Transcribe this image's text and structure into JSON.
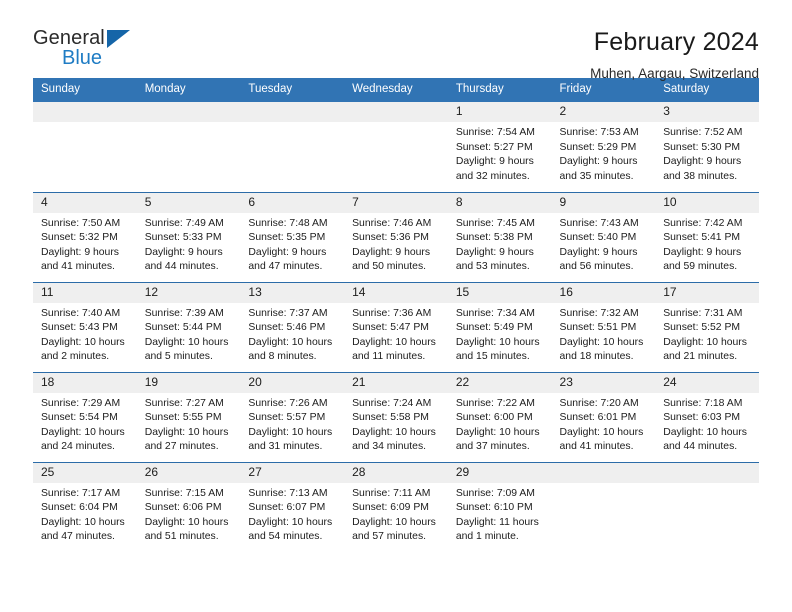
{
  "logo": {
    "word_one": "General",
    "word_two": "Blue",
    "triangle": "triangle-mark"
  },
  "header": {
    "title": "February 2024",
    "location": "Muhen, Aargau, Switzerland"
  },
  "calendar": {
    "weekdays": [
      "Sunday",
      "Monday",
      "Tuesday",
      "Wednesday",
      "Thursday",
      "Friday",
      "Saturday"
    ],
    "accent_color": "#3174b4",
    "rule_color": "#2c6ca8",
    "daynum_band_color": "#efefef",
    "weeks": [
      [
        {
          "day": ""
        },
        {
          "day": ""
        },
        {
          "day": ""
        },
        {
          "day": ""
        },
        {
          "day": "1",
          "sunrise": "Sunrise: 7:54 AM",
          "sunset": "Sunset: 5:27 PM",
          "daylight_line1": "Daylight: 9 hours",
          "daylight_line2": "and 32 minutes."
        },
        {
          "day": "2",
          "sunrise": "Sunrise: 7:53 AM",
          "sunset": "Sunset: 5:29 PM",
          "daylight_line1": "Daylight: 9 hours",
          "daylight_line2": "and 35 minutes."
        },
        {
          "day": "3",
          "sunrise": "Sunrise: 7:52 AM",
          "sunset": "Sunset: 5:30 PM",
          "daylight_line1": "Daylight: 9 hours",
          "daylight_line2": "and 38 minutes."
        }
      ],
      [
        {
          "day": "4",
          "sunrise": "Sunrise: 7:50 AM",
          "sunset": "Sunset: 5:32 PM",
          "daylight_line1": "Daylight: 9 hours",
          "daylight_line2": "and 41 minutes."
        },
        {
          "day": "5",
          "sunrise": "Sunrise: 7:49 AM",
          "sunset": "Sunset: 5:33 PM",
          "daylight_line1": "Daylight: 9 hours",
          "daylight_line2": "and 44 minutes."
        },
        {
          "day": "6",
          "sunrise": "Sunrise: 7:48 AM",
          "sunset": "Sunset: 5:35 PM",
          "daylight_line1": "Daylight: 9 hours",
          "daylight_line2": "and 47 minutes."
        },
        {
          "day": "7",
          "sunrise": "Sunrise: 7:46 AM",
          "sunset": "Sunset: 5:36 PM",
          "daylight_line1": "Daylight: 9 hours",
          "daylight_line2": "and 50 minutes."
        },
        {
          "day": "8",
          "sunrise": "Sunrise: 7:45 AM",
          "sunset": "Sunset: 5:38 PM",
          "daylight_line1": "Daylight: 9 hours",
          "daylight_line2": "and 53 minutes."
        },
        {
          "day": "9",
          "sunrise": "Sunrise: 7:43 AM",
          "sunset": "Sunset: 5:40 PM",
          "daylight_line1": "Daylight: 9 hours",
          "daylight_line2": "and 56 minutes."
        },
        {
          "day": "10",
          "sunrise": "Sunrise: 7:42 AM",
          "sunset": "Sunset: 5:41 PM",
          "daylight_line1": "Daylight: 9 hours",
          "daylight_line2": "and 59 minutes."
        }
      ],
      [
        {
          "day": "11",
          "sunrise": "Sunrise: 7:40 AM",
          "sunset": "Sunset: 5:43 PM",
          "daylight_line1": "Daylight: 10 hours",
          "daylight_line2": "and 2 minutes."
        },
        {
          "day": "12",
          "sunrise": "Sunrise: 7:39 AM",
          "sunset": "Sunset: 5:44 PM",
          "daylight_line1": "Daylight: 10 hours",
          "daylight_line2": "and 5 minutes."
        },
        {
          "day": "13",
          "sunrise": "Sunrise: 7:37 AM",
          "sunset": "Sunset: 5:46 PM",
          "daylight_line1": "Daylight: 10 hours",
          "daylight_line2": "and 8 minutes."
        },
        {
          "day": "14",
          "sunrise": "Sunrise: 7:36 AM",
          "sunset": "Sunset: 5:47 PM",
          "daylight_line1": "Daylight: 10 hours",
          "daylight_line2": "and 11 minutes."
        },
        {
          "day": "15",
          "sunrise": "Sunrise: 7:34 AM",
          "sunset": "Sunset: 5:49 PM",
          "daylight_line1": "Daylight: 10 hours",
          "daylight_line2": "and 15 minutes."
        },
        {
          "day": "16",
          "sunrise": "Sunrise: 7:32 AM",
          "sunset": "Sunset: 5:51 PM",
          "daylight_line1": "Daylight: 10 hours",
          "daylight_line2": "and 18 minutes."
        },
        {
          "day": "17",
          "sunrise": "Sunrise: 7:31 AM",
          "sunset": "Sunset: 5:52 PM",
          "daylight_line1": "Daylight: 10 hours",
          "daylight_line2": "and 21 minutes."
        }
      ],
      [
        {
          "day": "18",
          "sunrise": "Sunrise: 7:29 AM",
          "sunset": "Sunset: 5:54 PM",
          "daylight_line1": "Daylight: 10 hours",
          "daylight_line2": "and 24 minutes."
        },
        {
          "day": "19",
          "sunrise": "Sunrise: 7:27 AM",
          "sunset": "Sunset: 5:55 PM",
          "daylight_line1": "Daylight: 10 hours",
          "daylight_line2": "and 27 minutes."
        },
        {
          "day": "20",
          "sunrise": "Sunrise: 7:26 AM",
          "sunset": "Sunset: 5:57 PM",
          "daylight_line1": "Daylight: 10 hours",
          "daylight_line2": "and 31 minutes."
        },
        {
          "day": "21",
          "sunrise": "Sunrise: 7:24 AM",
          "sunset": "Sunset: 5:58 PM",
          "daylight_line1": "Daylight: 10 hours",
          "daylight_line2": "and 34 minutes."
        },
        {
          "day": "22",
          "sunrise": "Sunrise: 7:22 AM",
          "sunset": "Sunset: 6:00 PM",
          "daylight_line1": "Daylight: 10 hours",
          "daylight_line2": "and 37 minutes."
        },
        {
          "day": "23",
          "sunrise": "Sunrise: 7:20 AM",
          "sunset": "Sunset: 6:01 PM",
          "daylight_line1": "Daylight: 10 hours",
          "daylight_line2": "and 41 minutes."
        },
        {
          "day": "24",
          "sunrise": "Sunrise: 7:18 AM",
          "sunset": "Sunset: 6:03 PM",
          "daylight_line1": "Daylight: 10 hours",
          "daylight_line2": "and 44 minutes."
        }
      ],
      [
        {
          "day": "25",
          "sunrise": "Sunrise: 7:17 AM",
          "sunset": "Sunset: 6:04 PM",
          "daylight_line1": "Daylight: 10 hours",
          "daylight_line2": "and 47 minutes."
        },
        {
          "day": "26",
          "sunrise": "Sunrise: 7:15 AM",
          "sunset": "Sunset: 6:06 PM",
          "daylight_line1": "Daylight: 10 hours",
          "daylight_line2": "and 51 minutes."
        },
        {
          "day": "27",
          "sunrise": "Sunrise: 7:13 AM",
          "sunset": "Sunset: 6:07 PM",
          "daylight_line1": "Daylight: 10 hours",
          "daylight_line2": "and 54 minutes."
        },
        {
          "day": "28",
          "sunrise": "Sunrise: 7:11 AM",
          "sunset": "Sunset: 6:09 PM",
          "daylight_line1": "Daylight: 10 hours",
          "daylight_line2": "and 57 minutes."
        },
        {
          "day": "29",
          "sunrise": "Sunrise: 7:09 AM",
          "sunset": "Sunset: 6:10 PM",
          "daylight_line1": "Daylight: 11 hours",
          "daylight_line2": "and 1 minute."
        },
        {
          "day": ""
        },
        {
          "day": ""
        }
      ]
    ]
  }
}
